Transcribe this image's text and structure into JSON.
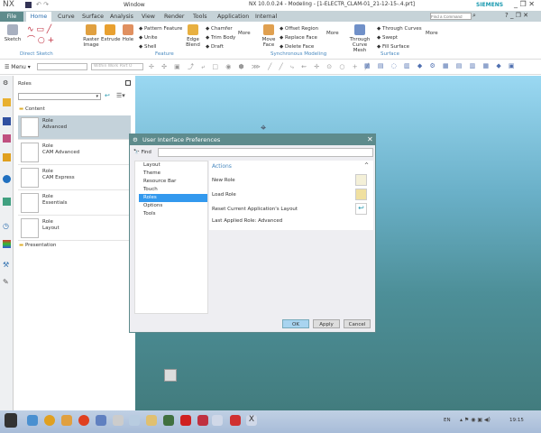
{
  "app": {
    "logo": "NX",
    "title": "NX 10.0.0.24 - Modeling - [1-ELECTR_CLAM-01_21-12-15-.4.prt]",
    "brand": "SIEMENS",
    "window_menu": "Window"
  },
  "tabs": [
    "File",
    "Home",
    "Curve",
    "Surface",
    "Analysis",
    "View",
    "Render",
    "Tools",
    "Application",
    "Internal"
  ],
  "active_tab": "Home",
  "search": {
    "placeholder": "Find a Command"
  },
  "ribbon": {
    "sketch": "Sketch",
    "direct_sketch": "Direct Sketch",
    "raster": "Raster Image",
    "extrude": "Extrude",
    "hole": "Hole",
    "pattern": "Pattern Feature",
    "unite": "Unite",
    "shell": "Shell",
    "edge_blend": "Edge Blend",
    "chamfer": "Chamfer",
    "trim_body": "Trim Body",
    "draft": "Draft",
    "more": "More",
    "feature": "Feature",
    "move_face": "Move Face",
    "offset_region": "Offset Region",
    "replace_face": "Replace Face",
    "delete_face": "Delete Face",
    "sync": "Synchronous Modeling",
    "through_curve_mesh": "Through Curve Mesh",
    "through_curves": "Through Curves",
    "swept": "Swept",
    "fill_surface": "Fill Surface",
    "surface": "Surface"
  },
  "toolbar": {
    "menu": "Menu",
    "filter": "Within Work Part O"
  },
  "panel": {
    "title": "Roles",
    "content_folder": "Content",
    "presentation_folder": "Presentation",
    "roles": [
      {
        "t1": "Role",
        "t2": "Advanced"
      },
      {
        "t1": "Role",
        "t2": "CAM Advanced"
      },
      {
        "t1": "Role",
        "t2": "CAM Express"
      },
      {
        "t1": "Role",
        "t2": "Essentials"
      },
      {
        "t1": "Role",
        "t2": "Layout"
      }
    ]
  },
  "dialog": {
    "title": "User Interface Preferences",
    "find": "Find",
    "nav": [
      "Layout",
      "Theme",
      "Resource Bar",
      "Touch",
      "Roles",
      "Options",
      "Tools"
    ],
    "selected_nav": "Roles",
    "section": "Actions",
    "new_role": "New Role",
    "load_role": "Load Role",
    "reset": "Reset Current Application's Layout",
    "last_applied": "Last Applied Role: Advanced",
    "ok": "OK",
    "apply": "Apply",
    "cancel": "Cancel"
  },
  "taskbar": {
    "lang": "EN",
    "time": "19:15"
  }
}
